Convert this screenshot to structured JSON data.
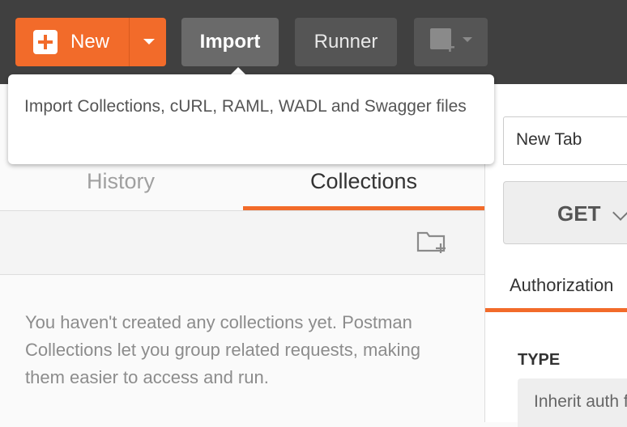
{
  "toolbar": {
    "new_label": "New",
    "import_label": "Import",
    "runner_label": "Runner"
  },
  "tooltip": {
    "text": "Import Collections, cURL, RAML, WADL and Swagger files"
  },
  "sidebar": {
    "tabs": [
      {
        "label": "History",
        "active": false
      },
      {
        "label": "Collections",
        "active": true
      }
    ],
    "empty_message": "You haven't created any collections yet. Postman Collections let you group related requests, making them easier to access and run."
  },
  "request": {
    "tab_label": "New Tab",
    "method": "GET",
    "section_tab": "Authorization",
    "type_label": "TYPE",
    "type_value": "Inherit auth from parent"
  },
  "colors": {
    "accent": "#f26b2a",
    "topbar": "#404040"
  }
}
